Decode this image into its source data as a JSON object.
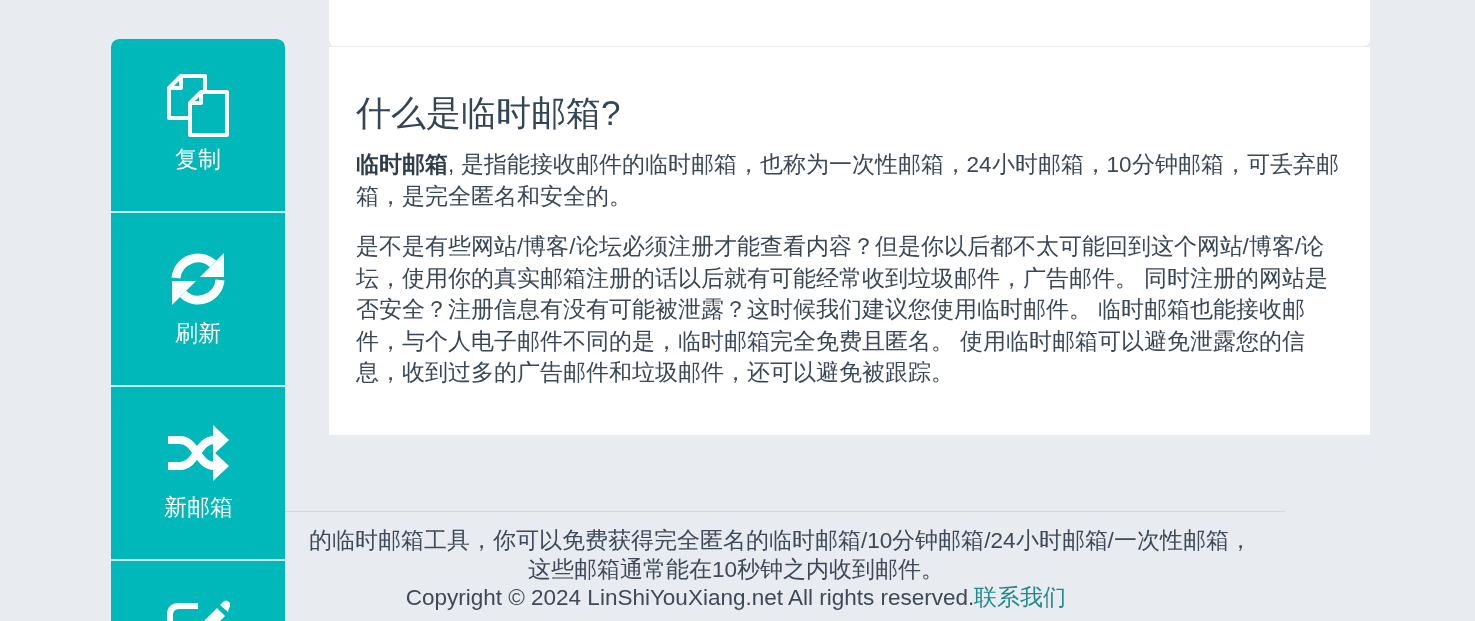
{
  "sidebar": {
    "buttons": [
      {
        "kind": "copy",
        "label": "复制"
      },
      {
        "kind": "refresh",
        "label": "刷新"
      },
      {
        "kind": "shuffle",
        "label": "新邮箱"
      },
      {
        "kind": "edit"
      }
    ]
  },
  "info": {
    "title": "什么是临时邮箱?",
    "paragraphs": [
      "**临时邮箱**, 是指能接收邮件的临时邮箱，也称为一次性邮箱，24小时邮箱，10分钟邮箱，可丢弃邮箱，是完全匿名和安全的。",
      "是不是有些网站/博客/论坛必须注册才能查看内容？但是你以后都不太可能回到这个网站/博客/论坛，使用你的真实邮箱注册的话以后就有可能经常收到垃圾邮件，广告邮件。 同时注册的网站是否安全？注册信息有没有可能被泄露？这时候我们建议您使用临时邮件。 临时邮箱也能接收邮件，与个人电子邮件不同的是，临时邮箱完全免费且匿名。 使用临时邮箱可以避免泄露您的信息，收到过多的广告邮件和垃圾邮件，还可以避免被跟踪。"
    ]
  },
  "footer": {
    "lines": [
      "的临时邮箱工具，你可以免费获得完全匿名的临时邮箱/10分钟邮箱/24小时邮箱/一次性邮箱，",
      "这些邮箱通常能在10秒钟之内收到邮件。"
    ],
    "copyright": "Copyright © 2024 LinShiYouXiang.net All rights reserved.",
    "contact_link": "联系我们"
  }
}
